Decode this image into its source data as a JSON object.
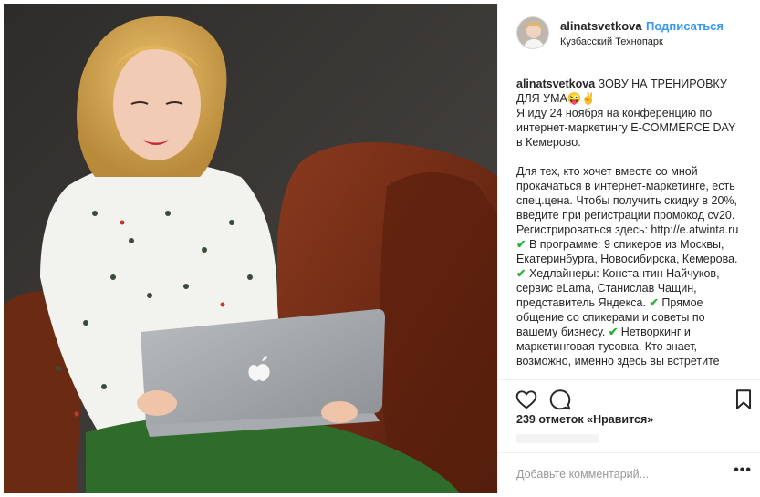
{
  "post": {
    "username": "alinatsvetkova",
    "separator": "•",
    "follow_label": "Подписаться",
    "location": "Кузбасский Технопарк"
  },
  "caption": {
    "username": "alinatsvetkova",
    "title": "ЗОВУ НА ТРЕНИРОВКУ ДЛЯ УМА😜✌",
    "p1": "Я иду 24 ноября на конференцию по интернет-маркетингу E-COMMERCE DAY в Кемерово.",
    "p2a": "Для тех, кто хочет вместе со мной прокачаться в интернет-маркетинге, есть спец.цена. Чтобы получить скидку в 20%, введите при регистрации промокод cv20. Регистрироваться здесь: http://e.atwinta.ru",
    "check": "✔",
    "p2b": " В программе: 9 спикеров из Москвы, Екатеринбурга, Новосибирска, Кемерова.",
    "p3": " Хедлайнеры: Константин Найчуков, сервис eLama, Станислав Чащин, представитель Яндекса.",
    "p4": " Прямое общение со спикерами и советы по вашему бизнесу.",
    "p5": " Нетворкинг и маркетинговая тусовка. Кто знает, возможно, именно здесь вы встретите"
  },
  "actions": {
    "like_icon": "heart-icon",
    "comment_icon": "comment-icon",
    "save_icon": "bookmark-icon"
  },
  "likes_text": "239 отметок «Нравится»",
  "comment": {
    "placeholder": "Добавьте комментарий...",
    "more_label": "•••"
  },
  "colors": {
    "link_blue": "#3897f0",
    "text": "#262626",
    "check_green": "#2eae3b"
  }
}
